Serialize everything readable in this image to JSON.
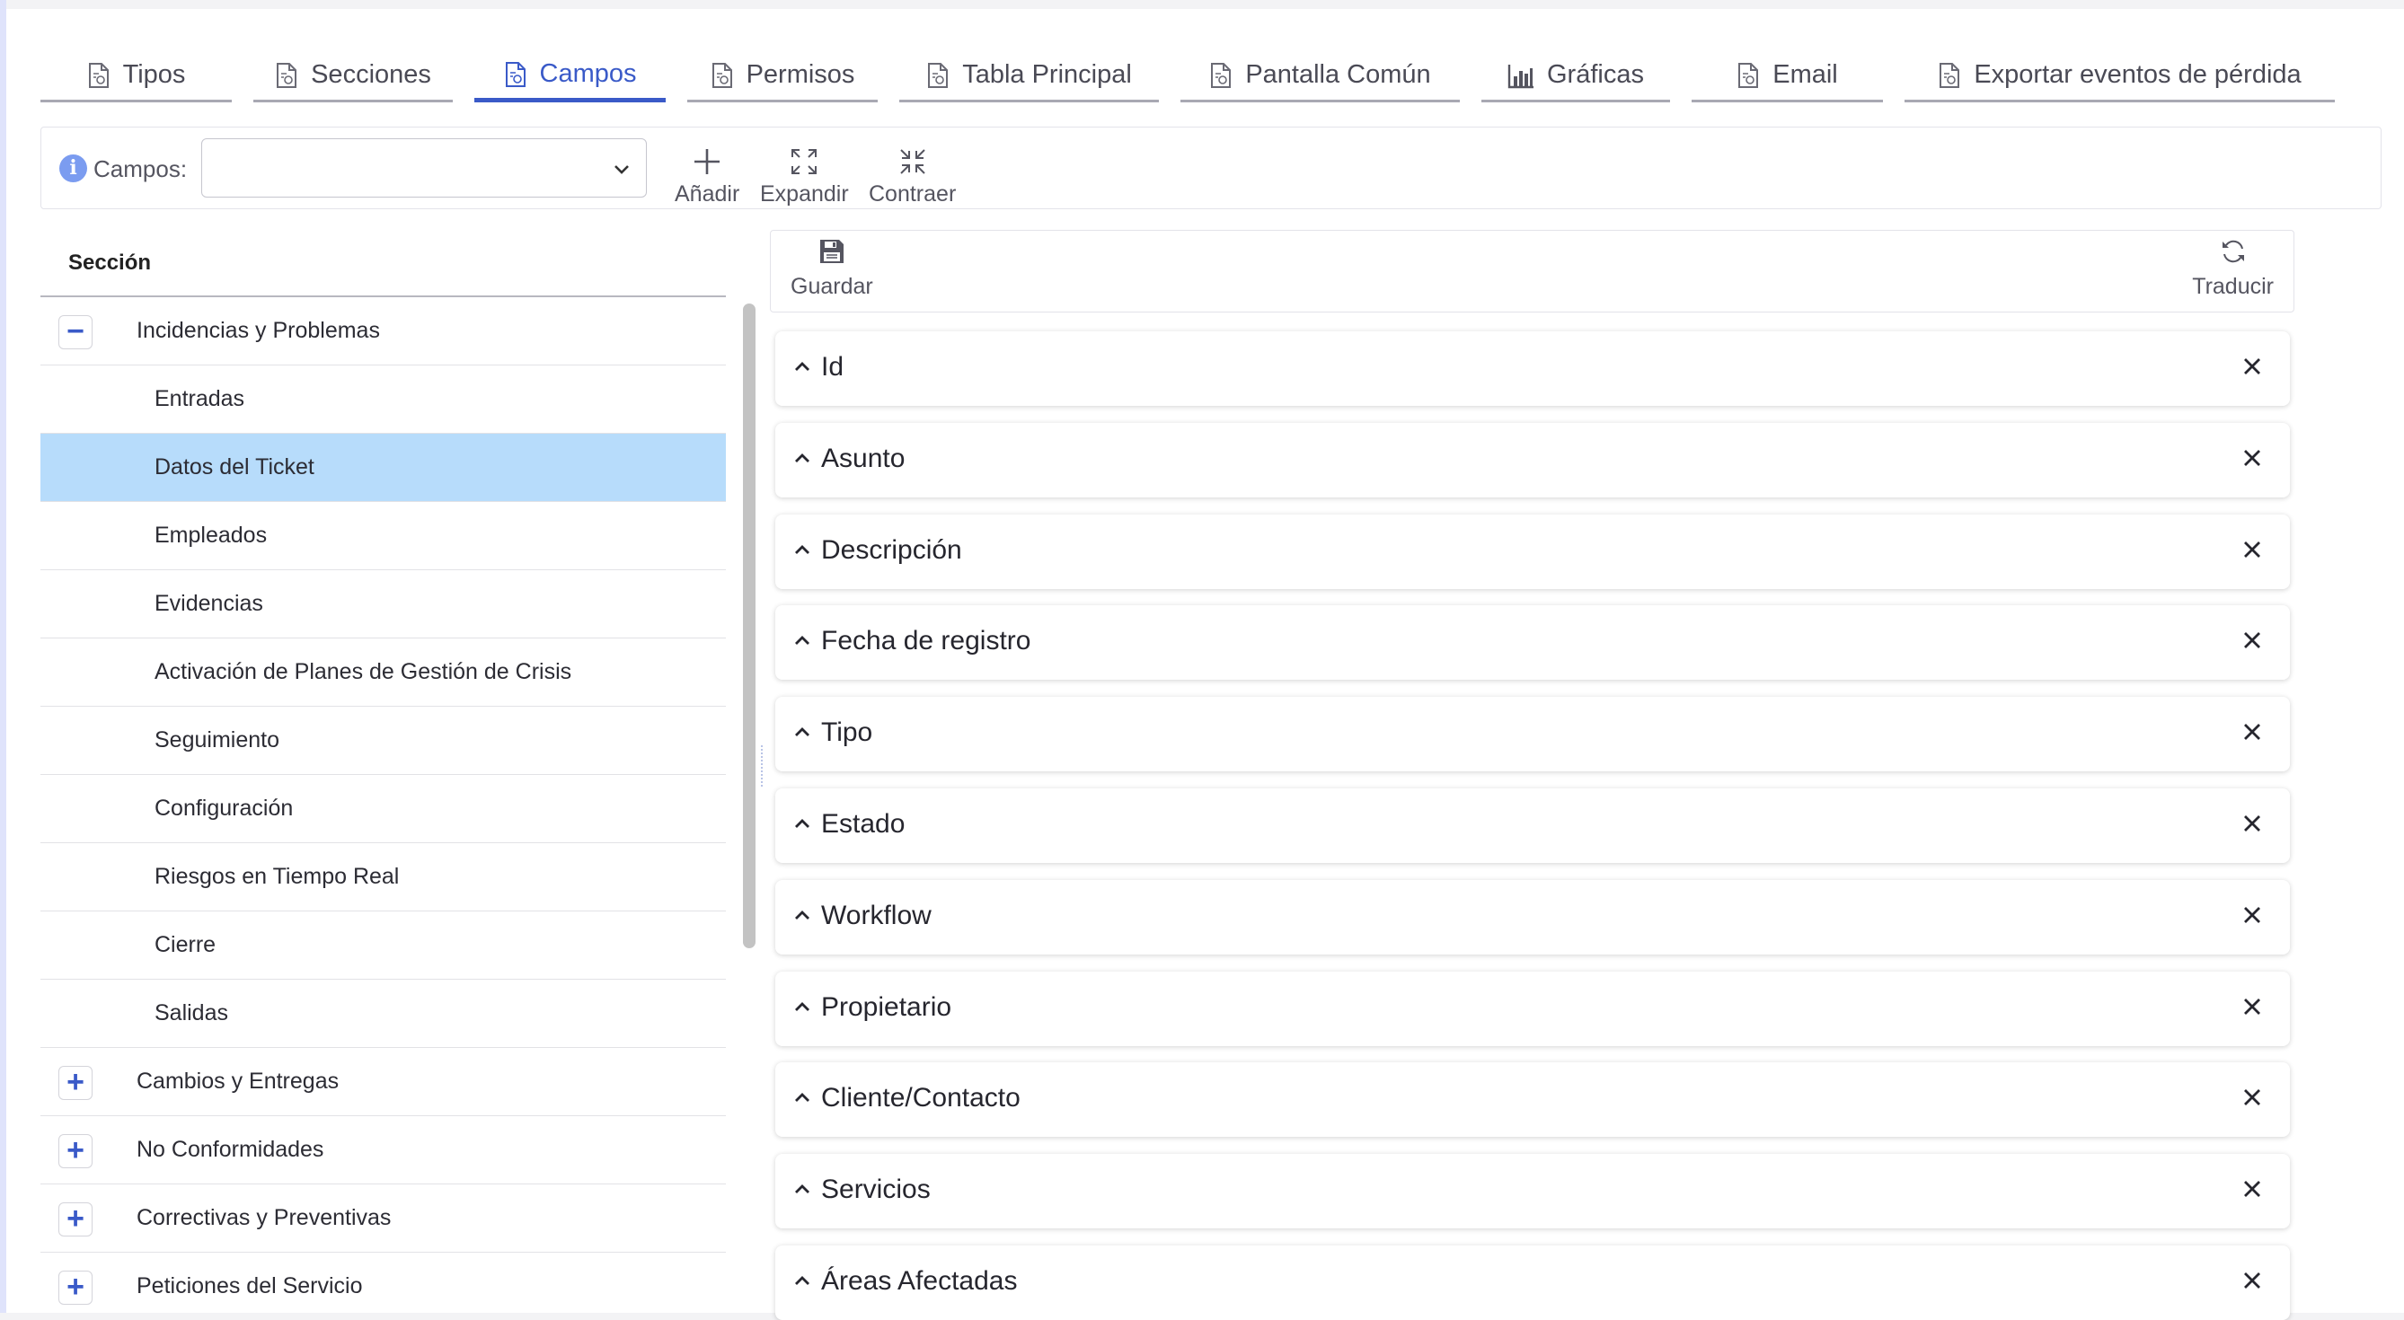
{
  "tabs": [
    {
      "label": "Tipos",
      "icon": "document-icon",
      "active": false
    },
    {
      "label": "Secciones",
      "icon": "document-icon",
      "active": false
    },
    {
      "label": "Campos",
      "icon": "document-icon",
      "active": true
    },
    {
      "label": "Permisos",
      "icon": "document-icon",
      "active": false
    },
    {
      "label": "Tabla Principal",
      "icon": "document-icon",
      "active": false
    },
    {
      "label": "Pantalla Común",
      "icon": "document-icon",
      "active": false
    },
    {
      "label": "Gráficas",
      "icon": "bar-chart-icon",
      "active": false
    },
    {
      "label": "Email",
      "icon": "document-icon",
      "active": false
    },
    {
      "label": "Exportar eventos de pérdida",
      "icon": "document-icon",
      "active": false
    }
  ],
  "toolbar": {
    "campos_label": "Campos:",
    "select_value": "",
    "add_label": "Añadir",
    "expand_label": "Expandir",
    "collapse_label": "Contraer"
  },
  "left_panel": {
    "header": "Sección",
    "rows": [
      {
        "label": "Incidencias y Problemas",
        "type": "parent",
        "toggle": "−"
      },
      {
        "label": "Entradas",
        "type": "child"
      },
      {
        "label": "Datos del Ticket",
        "type": "child",
        "selected": true
      },
      {
        "label": "Empleados",
        "type": "child"
      },
      {
        "label": "Evidencias",
        "type": "child"
      },
      {
        "label": "Activación de Planes de Gestión de Crisis",
        "type": "child"
      },
      {
        "label": "Seguimiento",
        "type": "child"
      },
      {
        "label": "Configuración",
        "type": "child"
      },
      {
        "label": "Riesgos en Tiempo Real",
        "type": "child"
      },
      {
        "label": "Cierre",
        "type": "child"
      },
      {
        "label": "Salidas",
        "type": "child"
      },
      {
        "label": "Cambios y Entregas",
        "type": "parent",
        "toggle": "+"
      },
      {
        "label": "No Conformidades",
        "type": "parent",
        "toggle": "+"
      },
      {
        "label": "Correctivas y Preventivas",
        "type": "parent",
        "toggle": "+"
      },
      {
        "label": "Peticiones del Servicio",
        "type": "parent",
        "toggle": "+"
      }
    ]
  },
  "right_panel": {
    "save_label": "Guardar",
    "translate_label": "Traducir",
    "fields": [
      "Id",
      "Asunto",
      "Descripción",
      "Fecha de registro",
      "Tipo",
      "Estado",
      "Workflow",
      "Propietario",
      "Cliente/Contacto",
      "Servicios",
      "Áreas Afectadas"
    ]
  },
  "colors": {
    "accent": "#3a5ac8",
    "selected_row": "#b7dcfb",
    "info_icon": "#7b9cf0"
  }
}
